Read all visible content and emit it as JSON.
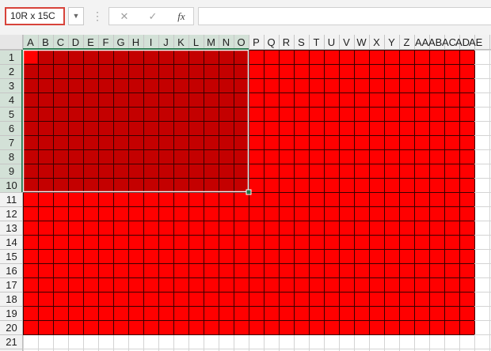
{
  "name_box": {
    "value": "10R x 15C"
  },
  "formula_bar": {
    "cancel_icon": "x-icon",
    "enter_icon": "check-icon",
    "fx_label": "fx",
    "value": ""
  },
  "sheet": {
    "column_labels": [
      "A",
      "B",
      "C",
      "D",
      "E",
      "F",
      "G",
      "H",
      "I",
      "J",
      "K",
      "L",
      "M",
      "N",
      "O",
      "P",
      "Q",
      "R",
      "S",
      "T",
      "U",
      "V",
      "W",
      "X",
      "Y",
      "Z",
      "AA",
      "AB",
      "AC",
      "AD",
      "AE"
    ],
    "row_labels": [
      "1",
      "2",
      "3",
      "4",
      "5",
      "6",
      "7",
      "8",
      "9",
      "10",
      "11",
      "12",
      "13",
      "14",
      "15",
      "16",
      "17",
      "18",
      "19",
      "20",
      "21"
    ],
    "fill_color": "#ff0000",
    "selection_fill_color": "#c40000",
    "selection_border_color": "#217346",
    "red_fill_rows": 20,
    "red_fill_columns": 30,
    "selected_rows": 10,
    "selected_columns": 15
  }
}
